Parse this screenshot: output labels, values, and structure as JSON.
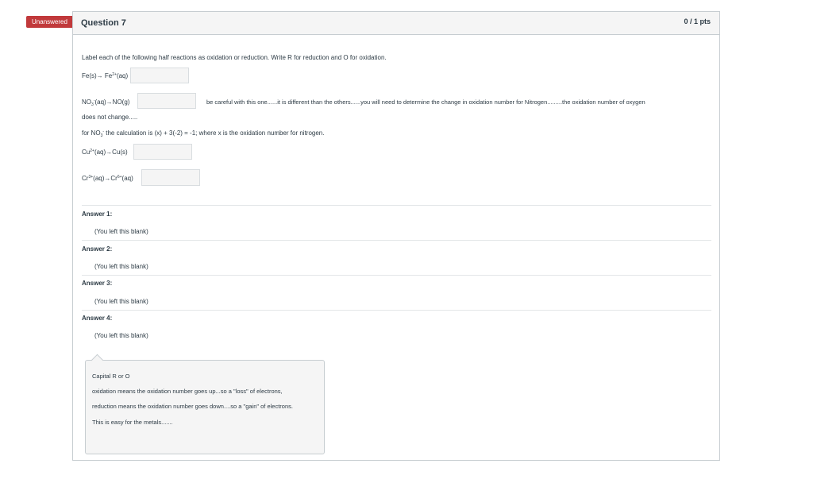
{
  "status_badge": "Unanswered",
  "question": {
    "title": "Question 7",
    "points": "0 / 1 pts",
    "instruction": "Label each of the following half reactions as oxidation or reduction. Write R for reduction and O for oxidation.",
    "reaction1": "Fe(s)→ Fe2+(aq)",
    "reaction2": "NO3-(aq)→NO(g)",
    "hint_line1": "be careful with this one......it is different than the others......you will need to determine the change in oxidation number for Nitrogen.........the oxidation number of oxygen",
    "hint_line2": "does not change.....",
    "calc_line": "for NO3- the calculation is (x) + 3(-2) = -1; where x is the oxidation number for nitrogen.",
    "reaction3": "Cu2+(aq)→Cu(s)",
    "reaction4": "Cr3+(aq)→Cr6+(aq)"
  },
  "answers": [
    {
      "label": "Answer 1:",
      "value": "(You left this blank)"
    },
    {
      "label": "Answer 2:",
      "value": "(You left this blank)"
    },
    {
      "label": "Answer 3:",
      "value": "(You left this blank)"
    },
    {
      "label": "Answer 4:",
      "value": "(You left this blank)"
    }
  ],
  "comment": {
    "lines": [
      "Capital R or O",
      "oxidation means the oxidation number goes up...so a \"loss\" of electrons,",
      "reduction means the oxidation number goes down....so a \"gain\" of electrons.",
      "This is easy for the metals......."
    ]
  }
}
